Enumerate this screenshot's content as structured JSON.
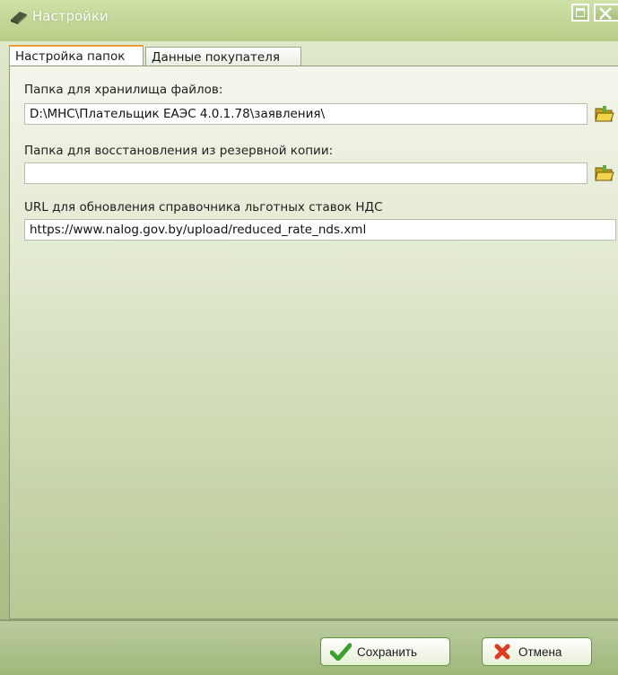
{
  "window": {
    "title": "Настройки"
  },
  "tabs": [
    {
      "label": "Настройка папок",
      "active": true
    },
    {
      "label": "Данные покупателя",
      "active": false
    }
  ],
  "fields": {
    "storage_folder": {
      "label": "Папка для хранилища файлов:",
      "value": "D:\\МНС\\Плательщик ЕАЭС 4.0.1.78\\заявления\\"
    },
    "restore_folder": {
      "label": "Папка для восстановления из резервной копии:",
      "value": ""
    },
    "update_url": {
      "label": "URL для обновления справочника льготных ставок НДС",
      "value": "https://www.nalog.gov.by/upload/reduced_rate_nds.xml"
    }
  },
  "buttons": {
    "save": "Сохранить",
    "cancel": "Отмена"
  },
  "icons": {
    "title": "book-icon",
    "browse": "folder-open-icon",
    "save": "checkmark-icon",
    "cancel": "cross-icon"
  },
  "colors": {
    "accent_tab": "#e89a3c",
    "button_border": "#5a9a3a",
    "save_check": "#3aa12c",
    "cancel_cross": "#e03a1e"
  }
}
